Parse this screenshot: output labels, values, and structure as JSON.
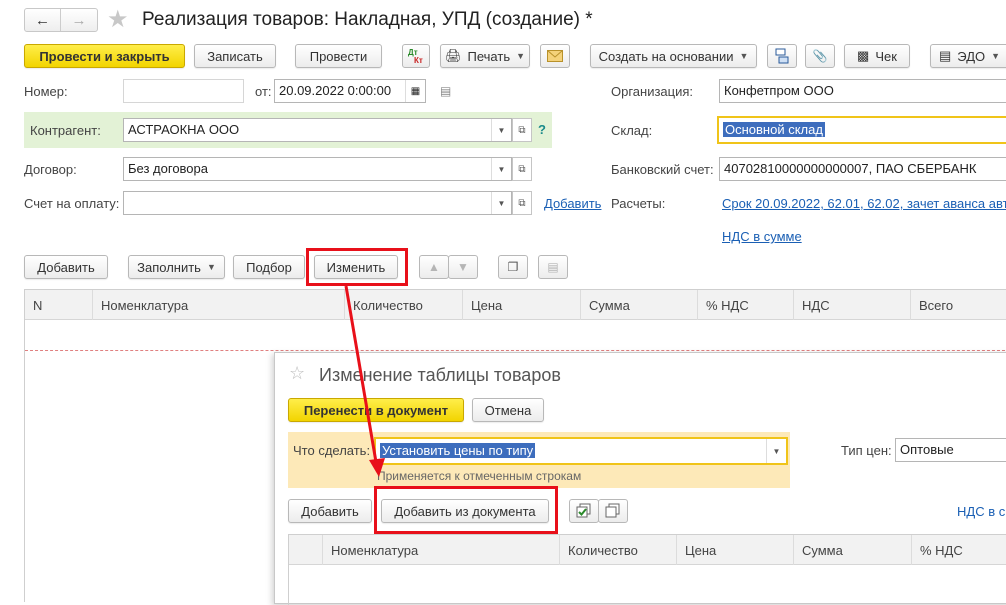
{
  "window": {
    "title": "Реализация товаров: Накладная, УПД (создание) *"
  },
  "toolbar": {
    "post_close": "Провести и закрыть",
    "save": "Записать",
    "post": "Провести",
    "dtkt": "Дт Кт",
    "print": "Печать",
    "create_based": "Создать на основании",
    "receipt": "Чек",
    "edo": "ЭДО"
  },
  "header": {
    "number_label": "Номер:",
    "number_value": "",
    "from_label": "от:",
    "date_value": "20.09.2022  0:00:00",
    "org_label": "Организация:",
    "org_value": "Конфетпром ООО",
    "counterparty_label": "Контрагент:",
    "counterparty_value": "АСТРАОКНА ООО",
    "help": "?",
    "warehouse_label": "Склад:",
    "warehouse_value": "Основной склад",
    "contract_label": "Договор:",
    "contract_value": "Без договора",
    "bank_label": "Банковский счет:",
    "bank_value": "40702810000000000007, ПАО СБЕРБАНК",
    "invoice_label": "Счет на оплату:",
    "invoice_value": "",
    "add_link": "Добавить",
    "settlements_label": "Расчеты:",
    "settlements_value": "Срок 20.09.2022, 62.01, 62.02, зачет аванса авт",
    "vat_link": "НДС в сумме"
  },
  "table_toolbar": {
    "add": "Добавить",
    "fill": "Заполнить",
    "pick": "Подбор",
    "change": "Изменить"
  },
  "table": {
    "columns": [
      "N",
      "Номенклатура",
      "Количество",
      "Цена",
      "Сумма",
      "% НДС",
      "НДС",
      "Всего"
    ]
  },
  "dialog": {
    "title": "Изменение таблицы товаров",
    "transfer": "Перенести в документ",
    "cancel": "Отмена",
    "action_label": "Что сделать:",
    "action_value": "Установить цены по типу",
    "hint": "Применяется к отмеченным строкам",
    "price_type_label": "Тип цен:",
    "price_type_value": "Оптовые",
    "add": "Добавить",
    "add_from_doc": "Добавить из документа",
    "vat_link": "НДС в с",
    "columns": [
      "Номенклатура",
      "Количество",
      "Цена",
      "Сумма",
      "% НДС"
    ]
  },
  "colors": {
    "primary_button": "#f2d400",
    "highlight_red": "#e8101a",
    "link": "#1a5fb4",
    "counterparty_bg": "#e3f2d6",
    "action_bg": "#fde9b8"
  }
}
